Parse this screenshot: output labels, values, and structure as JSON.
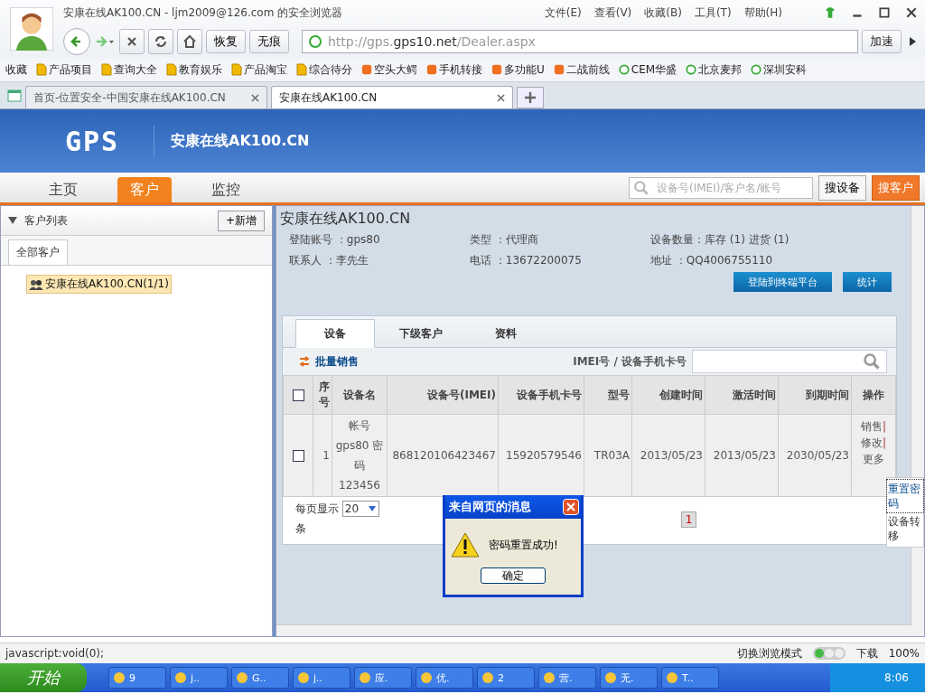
{
  "browser": {
    "title": "安康在线AK100.CN - ljm2009@126.com 的安全浏览器",
    "menu": [
      "文件(E)",
      "查看(V)",
      "收藏(B)",
      "工具(T)",
      "帮助(H)"
    ],
    "nav_buttons": [
      "恢复",
      "无痕"
    ],
    "address": {
      "prefix": "http://gps.",
      "host": "gps10.net",
      "path": "/Dealer.aspx"
    },
    "accelerate": "加速",
    "favorites": "收藏",
    "bookmarks": [
      {
        "label": "产品项目",
        "kind": "folder"
      },
      {
        "label": "查询大全",
        "kind": "folder"
      },
      {
        "label": "教育娱乐",
        "kind": "folder"
      },
      {
        "label": "产品淘宝",
        "kind": "folder"
      },
      {
        "label": "综合待分",
        "kind": "folder"
      },
      {
        "label": "空头大鳄",
        "kind": "site"
      },
      {
        "label": "手机转接",
        "kind": "site"
      },
      {
        "label": "多功能U",
        "kind": "site"
      },
      {
        "label": "二战前线",
        "kind": "site"
      },
      {
        "label": "CEM华盛",
        "kind": "page"
      },
      {
        "label": "北京麦邦",
        "kind": "page"
      },
      {
        "label": "深圳安科",
        "kind": "page"
      }
    ],
    "tabs": [
      {
        "label": "首页-位置安全-中国安康在线AK100.CN",
        "selected": false
      },
      {
        "label": "安康在线AK100.CN",
        "selected": true
      }
    ]
  },
  "app": {
    "logo": "GPS",
    "site_title": "安康在线AK100.CN",
    "nav": [
      {
        "label": "主页",
        "selected": false
      },
      {
        "label": "客户",
        "selected": true
      },
      {
        "label": "监控",
        "selected": false
      }
    ],
    "search": {
      "placeholder": "设备号(IMEI)/客户名/账号"
    },
    "search_buttons": [
      {
        "label": "搜设备",
        "kind": "plain"
      },
      {
        "label": "搜客户",
        "kind": "primary"
      }
    ]
  },
  "sidebar": {
    "title": "客户列表",
    "add": "+新增",
    "tabs": [
      {
        "label": "全部客户",
        "selected": true
      }
    ],
    "tree": [
      {
        "label": "安康在线AK100.CN(1/1)",
        "selected": true
      }
    ]
  },
  "detail": {
    "title": "安康在线AK100.CN",
    "info": [
      "登陆账号 ：gps80",
      "类型 ：代理商",
      "设备数量：库存 (1) 进货 (1)",
      "联系人 ：李先生",
      "电话 ：13672200075",
      "地址 ：QQ4006755110"
    ],
    "buttons": [
      "登陆到终端平台",
      "统计"
    ],
    "tabs": [
      {
        "label": "设备",
        "selected": true
      },
      {
        "label": "下级客户",
        "selected": false
      },
      {
        "label": "资料",
        "selected": false
      }
    ],
    "batch": "批量销售",
    "search_label": "IMEI号 / 设备手机卡号",
    "table": {
      "all_checked": false,
      "columns": [
        "序号",
        "设备名",
        "设备号(IMEI)",
        "设备手机卡号",
        "型号",
        "创建时间",
        "激活时间",
        "到期时间",
        "操作"
      ],
      "action_separator": "|",
      "rows": [
        {
          "checked": false,
          "cells": [
            "1",
            "帐号 gps80 密码 123456",
            "868120106423467",
            "15920579546",
            "TR03A",
            "2013/05/23",
            "2013/05/23",
            "2030/05/23"
          ],
          "actions": [
            "销售",
            "修改",
            "更多"
          ]
        }
      ]
    },
    "page_size_label": "每页显示",
    "page_size": "20",
    "page_size_unit": "条",
    "pages": [
      {
        "label": "1",
        "selected": true
      }
    ],
    "more_menu": [
      {
        "label": "重置密码",
        "selected": true
      },
      {
        "label": "设备转移",
        "selected": false
      }
    ]
  },
  "dialog": {
    "title": "来自网页的消息",
    "message": "密码重置成功!",
    "button": "确定"
  },
  "status_bar": {
    "text": "javascript:void(0);",
    "mode": "切换浏览模式",
    "download": "下载",
    "zoom": "100%"
  },
  "taskbar": {
    "start": "开始",
    "items": [
      "9",
      "j..",
      "G..",
      "j..",
      "应.",
      "优.",
      "2",
      "营.",
      "无.",
      "T.."
    ],
    "clock": "8:06"
  }
}
